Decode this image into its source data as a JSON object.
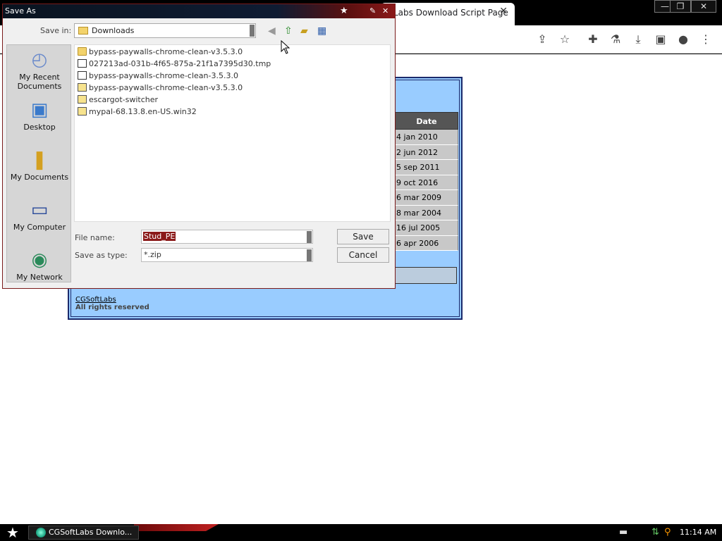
{
  "browser": {
    "tab_title": "Labs Download Script Page",
    "tab_close": "✕",
    "window_controls": [
      "—",
      "❐",
      "✕"
    ],
    "toolbar_icons": [
      "share-icon",
      "star-icon",
      "extensions-icon",
      "lab-icon",
      "download-icon",
      "sidepanel-icon",
      "profile-icon",
      "menu-icon"
    ]
  },
  "page": {
    "table_header": "Date",
    "dates": [
      "4 jan 2010",
      "2 jun 2012",
      "5 sep 2011",
      "9 oct 2016",
      "6 mar 2009",
      "8 mar 2004",
      "16 jul 2005",
      "6 apr 2006"
    ],
    "footer_link": "CGSoftLabs",
    "footer_rights": "All rights reserved"
  },
  "dialog": {
    "title": "Save As",
    "save_in_label": "Save in:",
    "save_in_value": "Downloads",
    "places": [
      {
        "label": "My Recent Documents",
        "icon": "recent-documents-icon"
      },
      {
        "label": "Desktop",
        "icon": "desktop-icon"
      },
      {
        "label": "My Documents",
        "icon": "my-documents-icon"
      },
      {
        "label": "My Computer",
        "icon": "my-computer-icon"
      },
      {
        "label": "My Network",
        "icon": "my-network-icon"
      }
    ],
    "files": [
      {
        "name": "bypass-paywalls-chrome-clean-v3.5.3.0",
        "type": "folder"
      },
      {
        "name": "027213ad-031b-4f65-875a-21f1a7395d30.tmp",
        "type": "tmp"
      },
      {
        "name": "bypass-paywalls-chrome-clean-3.5.3.0",
        "type": "tmp"
      },
      {
        "name": "bypass-paywalls-chrome-clean-v3.5.3.0",
        "type": "zip"
      },
      {
        "name": "escargot-switcher",
        "type": "zip"
      },
      {
        "name": "mypal-68.13.8.en-US.win32",
        "type": "zip"
      }
    ],
    "file_name_label": "File name:",
    "file_name_value": "Stud_PE",
    "save_type_label": "Save as type:",
    "save_type_value": "*.zip",
    "save_button": "Save",
    "cancel_button": "Cancel"
  },
  "taskbar": {
    "task_label": "CGSoftLabs Downlo...",
    "clock": "11:14 AM"
  }
}
